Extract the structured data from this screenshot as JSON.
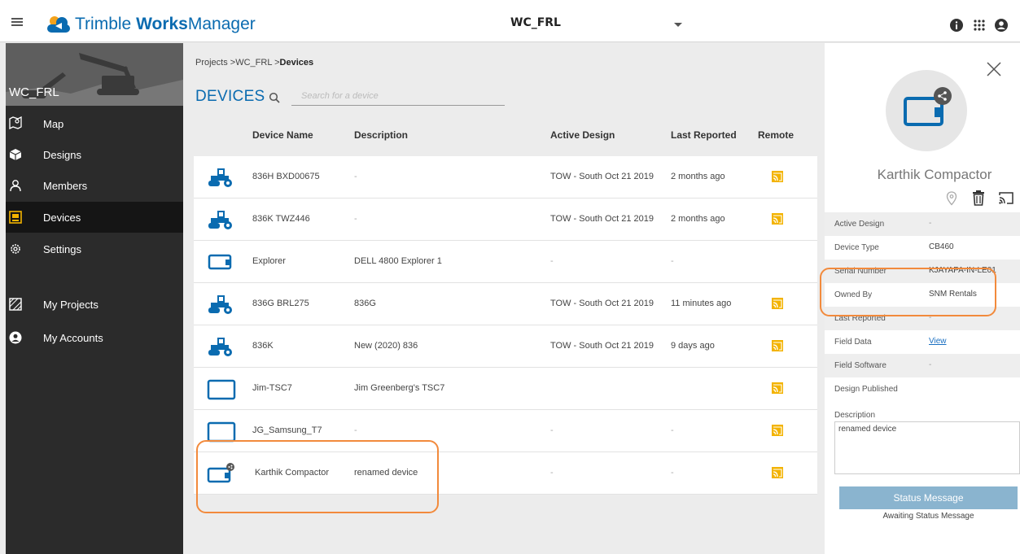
{
  "header": {
    "brand_part1": "Trimble ",
    "brand_part2": "Works",
    "brand_part3": "Manager",
    "project": "WC_FRL"
  },
  "sidebar": {
    "project_name": "WC_FRL",
    "items": [
      {
        "label": "Map",
        "icon": "map-pin-icon"
      },
      {
        "label": "Designs",
        "icon": "cube-icon"
      },
      {
        "label": "Members",
        "icon": "person-icon"
      },
      {
        "label": "Devices",
        "icon": "device-icon",
        "active": true
      },
      {
        "label": "Settings",
        "icon": "gear-icon"
      },
      {
        "label": "My Projects",
        "icon": "projects-icon"
      },
      {
        "label": "My Accounts",
        "icon": "account-icon"
      }
    ]
  },
  "breadcrumb": {
    "part1": "Projects",
    "part2": "WC_FRL",
    "part3": "Devices"
  },
  "page": {
    "title": "DEVICES",
    "search_placeholder": "Search for a device"
  },
  "table": {
    "headers": {
      "name": "Device Name",
      "description": "Description",
      "active_design": "Active Design",
      "last_reported": "Last Reported",
      "remote": "Remote"
    },
    "rows": [
      {
        "icon": "compactor",
        "name": "836H BXD00675",
        "description": "-",
        "active_design": "TOW - South Oct 21 2019",
        "last_reported": "2 months ago",
        "remote": true
      },
      {
        "icon": "compactor",
        "name": "836K TWZ446",
        "description": "-",
        "active_design": "TOW - South Oct 21 2019",
        "last_reported": "2 months ago",
        "remote": true
      },
      {
        "icon": "tablet",
        "name": "Explorer",
        "description": "DELL 4800 Explorer 1",
        "active_design": "-",
        "last_reported": "-",
        "remote": false
      },
      {
        "icon": "compactor",
        "name": "836G BRL275",
        "description": "836G",
        "active_design": "TOW - South Oct 21 2019",
        "last_reported": "11 minutes ago",
        "remote": true
      },
      {
        "icon": "compactor",
        "name": "836K",
        "description": "New (2020) 836",
        "active_design": "TOW - South Oct 21 2019",
        "last_reported": "9 days ago",
        "remote": true
      },
      {
        "icon": "tablet-large",
        "name": "Jim-TSC7",
        "description": "Jim Greenberg's TSC7",
        "active_design": "",
        "last_reported": "",
        "remote": true
      },
      {
        "icon": "tablet-large",
        "name": "JG_Samsung_T7",
        "description": "-",
        "active_design": "-",
        "last_reported": "-",
        "remote": true
      },
      {
        "icon": "tablet-shared",
        "name": "Karthik Compactor",
        "description": "renamed device",
        "active_design": "-",
        "last_reported": "-",
        "remote": true
      }
    ]
  },
  "detail": {
    "device_name": "Karthik Compactor",
    "fields": [
      {
        "label": "Active Design",
        "value": "-"
      },
      {
        "label": "Device Type",
        "value": "CB460"
      },
      {
        "label": "Serial Number",
        "value": "KJAYAPA-IN-LE01"
      },
      {
        "label": "Owned By",
        "value": "SNM Rentals"
      },
      {
        "label": "Last Reported",
        "value": "-"
      },
      {
        "label": "Field Data",
        "value": "View"
      },
      {
        "label": "Field Software",
        "value": "-"
      },
      {
        "label": "Design Published",
        "value": ""
      }
    ],
    "description_label": "Description",
    "description_value": "renamed device",
    "status_button": "Status Message",
    "status_text": "Awaiting Status Message"
  },
  "colors": {
    "brand": "#0a6bb0",
    "sidebar_bg": "#2b2b2b",
    "active_item": "#151515",
    "remote_icon": "#f3b300",
    "annotation": "#f28a3c",
    "status_button": "#8ab4cf"
  }
}
